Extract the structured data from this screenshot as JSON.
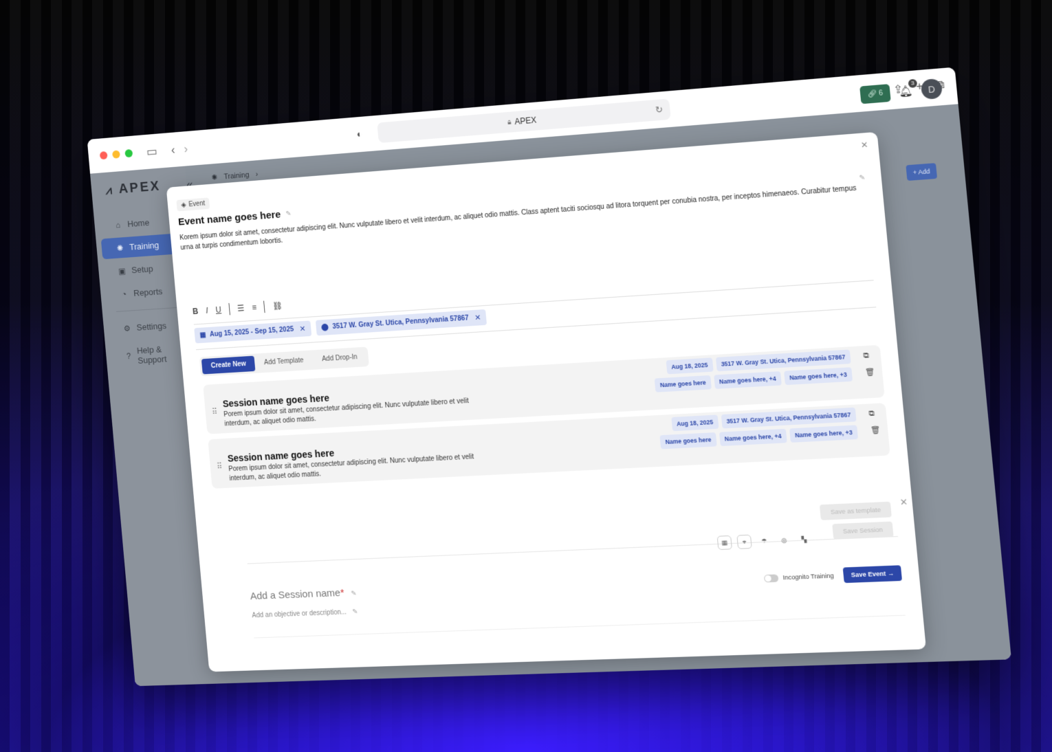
{
  "browser": {
    "address": "APEX",
    "icons": [
      "sidebar-toggle-icon",
      "back-icon",
      "forward-icon",
      "shield-icon",
      "download-icon",
      "share-icon",
      "new-tab-icon",
      "tabs-icon"
    ]
  },
  "app": {
    "logo_text": "APEX",
    "sidebar": {
      "items": [
        {
          "label": "Home",
          "icon": "home-icon"
        },
        {
          "label": "Training",
          "icon": "training-icon",
          "active": true
        },
        {
          "label": "Setup",
          "icon": "briefcase-icon"
        },
        {
          "label": "Reports",
          "icon": "chart-icon"
        }
      ],
      "secondary": [
        {
          "label": "Settings",
          "icon": "gear-icon"
        },
        {
          "label": "Help & Support",
          "icon": "help-icon"
        }
      ]
    },
    "breadcrumb": {
      "current": "Training"
    },
    "header": {
      "link_count": "6",
      "notif_count": "3",
      "avatar_initial": "D"
    },
    "add_label": "Add"
  },
  "modal": {
    "tag": "Event",
    "title": "Event name goes here",
    "description": "Korem ipsum dolor sit amet, consectetur adipiscing elit. Nunc vulputate libero et velit interdum, ac aliquet odio mattis. Class aptent taciti sociosqu ad litora torquent per conubia nostra, per inceptos himenaeos. Curabitur tempus urna at turpis condimentum lobortis.",
    "toolbar": [
      "B",
      "I",
      "U"
    ],
    "date_chip": "Aug 15, 2025 - Sep 15, 2025",
    "location_chip": "3517 W. Gray St. Utica, Pennsylvania 57867",
    "tabs": [
      "Create New",
      "Add Template",
      "Add Drop-In"
    ],
    "sessions": [
      {
        "title": "Session name goes here",
        "desc": "Porem ipsum dolor sit amet, consectetur adipiscing elit. Nunc vulputate libero et velit interdum, ac aliquet odio mattis.",
        "date": "Aug 18, 2025",
        "location": "3517 W. Gray St. Utica, Pennsylvania 57867",
        "instructor": "Name goes here",
        "attendees": "Name goes here, +4",
        "groups": "Name goes here, +3"
      },
      {
        "title": "Session name goes here",
        "desc": "Porem ipsum dolor sit amet, consectetur adipiscing elit. Nunc vulputate libero et velit interdum, ac aliquet odio mattis.",
        "date": "Aug 18, 2025",
        "location": "3517 W. Gray St. Utica, Pennsylvania 57867",
        "instructor": "Name goes here",
        "attendees": "Name goes here, +4",
        "groups": "Name goes here, +3"
      }
    ],
    "composer": {
      "save_template": "Save as template",
      "save_session": "Save Session",
      "name_placeholder": "Add a Session name",
      "required_mark": "*",
      "objective_placeholder": "Add an objective or description...",
      "incognito_label": "Incognito Training",
      "save_event": "Save Event"
    }
  }
}
